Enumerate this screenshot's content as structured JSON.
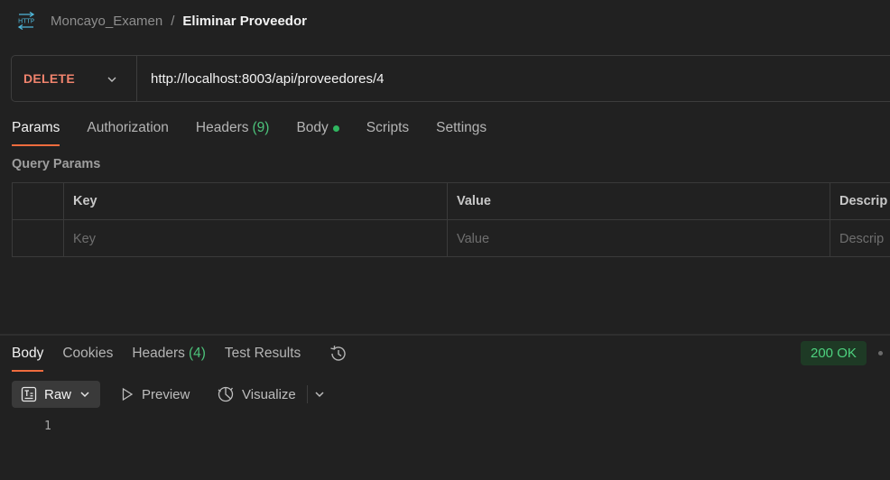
{
  "breadcrumb": {
    "icon": "http-icon",
    "parent": "Moncayo_Examen",
    "separator": "/",
    "current": "Eliminar Proveedor"
  },
  "request": {
    "method": "DELETE",
    "url": "http://localhost:8003/api/proveedores/4"
  },
  "request_tabs": [
    {
      "label": "Params",
      "active": true
    },
    {
      "label": "Authorization"
    },
    {
      "label": "Headers",
      "count": "(9)"
    },
    {
      "label": "Body",
      "dot": true
    },
    {
      "label": "Scripts"
    },
    {
      "label": "Settings"
    }
  ],
  "query_params": {
    "title": "Query Params",
    "headers": [
      "",
      "Key",
      "Value",
      "Descrip"
    ],
    "placeholders": [
      "",
      "Key",
      "Value",
      "Descrip"
    ]
  },
  "response_tabs": [
    {
      "label": "Body",
      "active": true
    },
    {
      "label": "Cookies"
    },
    {
      "label": "Headers",
      "count": "(4)"
    },
    {
      "label": "Test Results"
    }
  ],
  "status": {
    "text": "200 OK",
    "color": "#4dd17e"
  },
  "response_toolbar": {
    "raw": "Raw",
    "preview": "Preview",
    "visualize": "Visualize"
  },
  "response_body": {
    "line_numbers": [
      "1"
    ]
  },
  "colors": {
    "background": "#212121",
    "method_delete": "#f0836d",
    "tab_underline": "#ef6c3e",
    "count_green": "#4cc27a",
    "accent_icon": "#4fb7d9"
  }
}
